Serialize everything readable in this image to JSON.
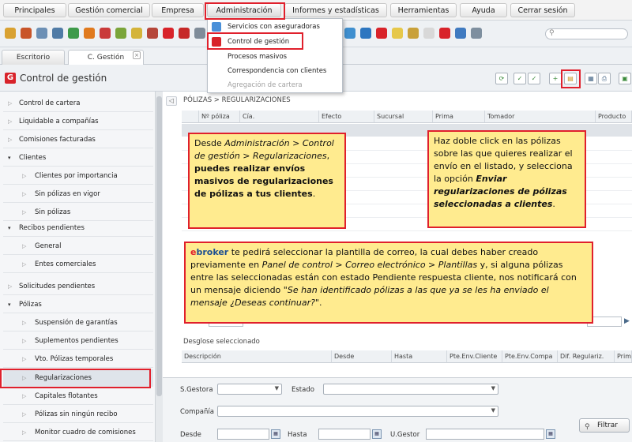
{
  "menubar": {
    "items": [
      "Principales",
      "Gestión comercial",
      "Empresa",
      "Administración",
      "Informes y estadísticas",
      "Herramientas",
      "Ayuda",
      "Cerrar sesión"
    ]
  },
  "admin_dropdown": {
    "items": [
      {
        "label": "Servicios con aseguradoras",
        "disabled": false
      },
      {
        "label": "Control de gestión",
        "disabled": false
      },
      {
        "label": "Procesos masivos",
        "disabled": false
      },
      {
        "label": "Correspondencia con clientes",
        "disabled": false
      },
      {
        "label": "Agregación de cartera",
        "disabled": true
      }
    ]
  },
  "tabs": [
    "Escritorio",
    "C. Gestión"
  ],
  "page": {
    "title": "Control de gestión",
    "logo_letter": "G"
  },
  "sidebar": {
    "items": [
      "Control de cartera",
      "Liquidable a compañías",
      "Comisiones facturadas",
      "Clientes",
      "Clientes por importancia",
      "Sin pólizas en vigor",
      "Sin pólizas",
      "Recibos pendientes",
      "General",
      "Entes comerciales",
      "Solicitudes pendientes",
      "Pólizas",
      "Suspensión de garantías",
      "Suplementos pendientes",
      "Vto. Pólizas temporales",
      "Regularizaciones",
      "Capitales flotantes",
      "Pólizas sin ningún recibo",
      "Monitor cuadro de comisiones"
    ]
  },
  "main": {
    "breadcrumb": "PÓLIZAS > REGULARIZACIONES",
    "grid_columns": [
      "Nº póliza",
      "Cía.",
      "Efecto",
      "Sucursal",
      "Prima",
      "Tomador",
      "Producto"
    ],
    "desglose_title": "Desglose seleccionado",
    "desglose_columns": [
      "Descripción",
      "Desde",
      "Hasta",
      "Pte.Env.Cliente",
      "Pte.Env.Compa",
      "Dif. Regulariz.",
      "Prim"
    ]
  },
  "filters": {
    "gestora_label": "S.Gestora",
    "estado_label": "Estado",
    "compania_label": "Compañía",
    "desde_label": "Desde",
    "hasta_label": "Hasta",
    "ugestor_label": "U.Gestor",
    "filter_button": "Filtrar"
  },
  "callouts": {
    "c1": {
      "pre": "Desde ",
      "italic1": "Administración > Control de gestión > Regularizaciones",
      "mid": ", ",
      "bold": "puedes realizar envíos masivos de regularizaciones de pólizas a tus clientes",
      "post": "."
    },
    "c2": {
      "pre": "Haz doble click en las pólizas sobre las que quieres realizar el envío en el listado, y selecciona la opción ",
      "bold_italic": "Enviar regularizaciones de pólizas seleccionadas a clientes",
      "post": "."
    },
    "c3": {
      "brand_e": "e",
      "brand_rest": "broker",
      "t1": " te pedirá seleccionar la plantilla de correo, la cual debes haber creado previamente en ",
      "i1": "Panel de control > Correo electrónico > Plantillas",
      "t2": " y, si alguna pólizas entre las seleccionadas están con estado Pendiente respuesta cliente, nos notificará con un mensaje diciendo \"",
      "i2": "Se han identificado pólizas a las que ya se les ha enviado el mensaje ¿Deseas continuar?",
      "t3": "\"."
    }
  },
  "colors": {
    "highlight": "#e0202c",
    "callout_bg": "#ffeb8f",
    "brand_red": "#d8232a"
  }
}
